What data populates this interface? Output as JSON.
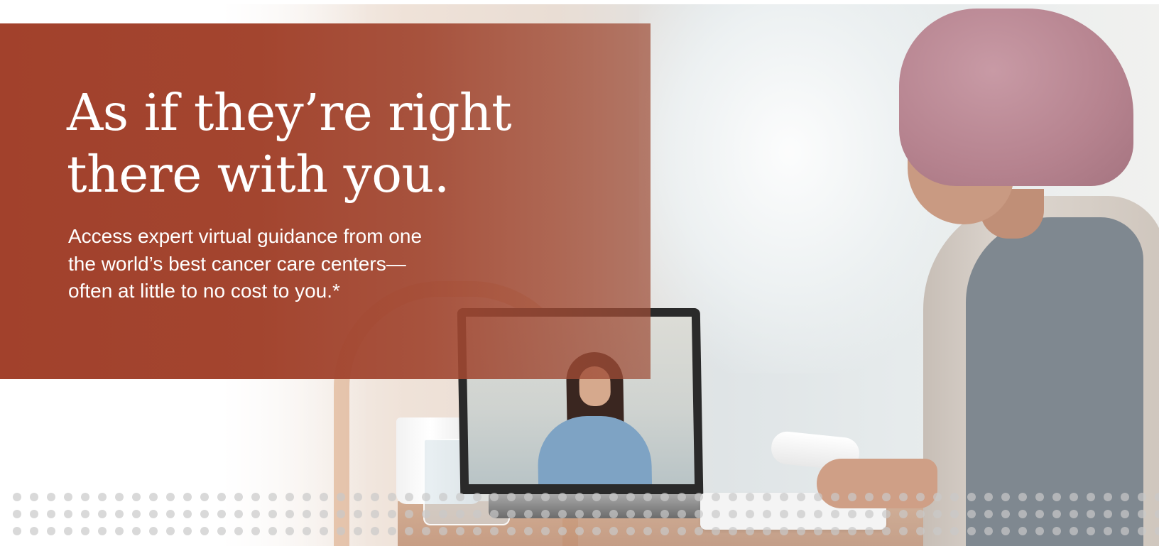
{
  "hero": {
    "headline_line1": "As if they’re right",
    "headline_line2": "there with you.",
    "subtext_line1": "Access expert virtual guidance from one",
    "subtext_line2": "the world’s best cancer care centers—",
    "subtext_line3": "often at little to no cost to you.*"
  },
  "colors": {
    "panel_accent": "#a2412c",
    "text_on_panel": "#ffffff"
  }
}
